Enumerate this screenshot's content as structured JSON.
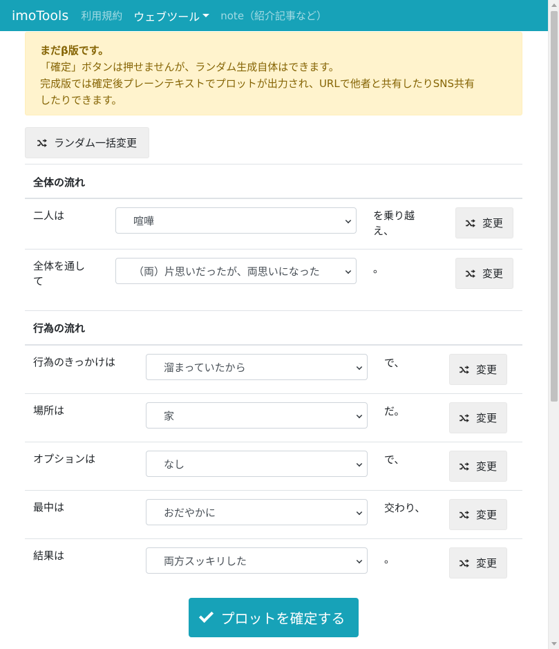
{
  "navbar": {
    "brand": "imoTools",
    "links": [
      "利用規約",
      "ウェブツール",
      "note（紹介記事など）"
    ],
    "bg_color": "#17a2b8"
  },
  "alert": {
    "title": "まだβ版です。",
    "line1": "「確定」ボタンは押せませんが、ランダム生成自体はできます。",
    "line2": "完成版では確定後プレーンテキストでプロットが出力され、URLで他者と共有したりSNS共有",
    "line3": "したりできます。"
  },
  "random_all_label": "ランダム一括変更",
  "change_label": "変更",
  "sections": [
    {
      "title": "全体の流れ",
      "rows": [
        {
          "label_l1": "二人は",
          "label_l2": "",
          "value": "喧嘩",
          "suffix_l1": "を乗り越",
          "suffix_l2": "え、"
        },
        {
          "label_l1": "全体を通し",
          "label_l2": "て",
          "value": "（両）片思いだったが、両思いになった",
          "suffix_l1": "。",
          "suffix_l2": ""
        }
      ]
    },
    {
      "title": "行為の流れ",
      "rows": [
        {
          "label_l1": "行為のきっかけは",
          "value": "溜まっていたから",
          "suffix_l1": "で、"
        },
        {
          "label_l1": "場所は",
          "value": "家",
          "suffix_l1": "だ。"
        },
        {
          "label_l1": "オプションは",
          "value": "なし",
          "suffix_l1": "で、"
        },
        {
          "label_l1": "最中は",
          "value": "おだやかに",
          "suffix_l1": "交わり、"
        },
        {
          "label_l1": "結果は",
          "value": "両方スッキリした",
          "suffix_l1": "。"
        }
      ]
    }
  ],
  "confirm_label": "プロットを確定する"
}
